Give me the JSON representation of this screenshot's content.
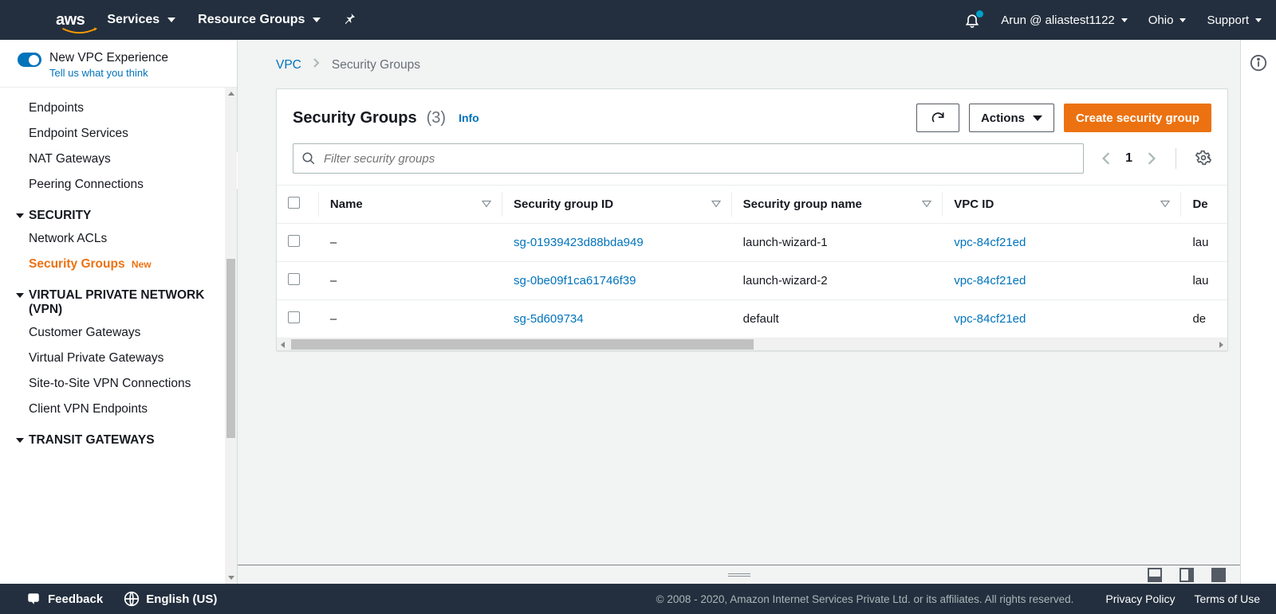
{
  "topnav": {
    "logo": "aws",
    "services": "Services",
    "resource_groups": "Resource Groups",
    "user": "Arun @ aliastest1122",
    "region": "Ohio",
    "support": "Support"
  },
  "sidebar": {
    "newvpc_title": "New VPC Experience",
    "newvpc_sub": "Tell us what you think",
    "items_pre": [
      "Endpoints",
      "Endpoint Services",
      "NAT Gateways",
      "Peering Connections"
    ],
    "section_security": "SECURITY",
    "security_items": [
      {
        "label": "Network ACLs"
      },
      {
        "label": "Security Groups",
        "active": true,
        "new": "New"
      }
    ],
    "section_vpn": "VIRTUAL PRIVATE NETWORK (VPN)",
    "vpn_items": [
      "Customer Gateways",
      "Virtual Private Gateways",
      "Site-to-Site VPN Connections",
      "Client VPN Endpoints"
    ],
    "section_tgw": "TRANSIT GATEWAYS"
  },
  "breadcrumb": {
    "root": "VPC",
    "current": "Security Groups"
  },
  "panel": {
    "title": "Security Groups",
    "count": "(3)",
    "info": "Info",
    "actions": "Actions",
    "create": "Create security group",
    "filter_placeholder": "Filter security groups",
    "page": "1"
  },
  "table": {
    "cols": [
      "Name",
      "Security group ID",
      "Security group name",
      "VPC ID",
      "De"
    ],
    "rows": [
      {
        "name": "–",
        "sgid": "sg-01939423d88bda949",
        "sgname": "launch-wizard-1",
        "vpc": "vpc-84cf21ed",
        "desc": "lau"
      },
      {
        "name": "–",
        "sgid": "sg-0be09f1ca61746f39",
        "sgname": "launch-wizard-2",
        "vpc": "vpc-84cf21ed",
        "desc": "lau"
      },
      {
        "name": "–",
        "sgid": "sg-5d609734",
        "sgname": "default",
        "vpc": "vpc-84cf21ed",
        "desc": "de"
      }
    ]
  },
  "footer": {
    "feedback": "Feedback",
    "lang": "English (US)",
    "copyright": "© 2008 - 2020, Amazon Internet Services Private Ltd. or its affiliates. All rights reserved.",
    "privacy": "Privacy Policy",
    "terms": "Terms of Use"
  }
}
